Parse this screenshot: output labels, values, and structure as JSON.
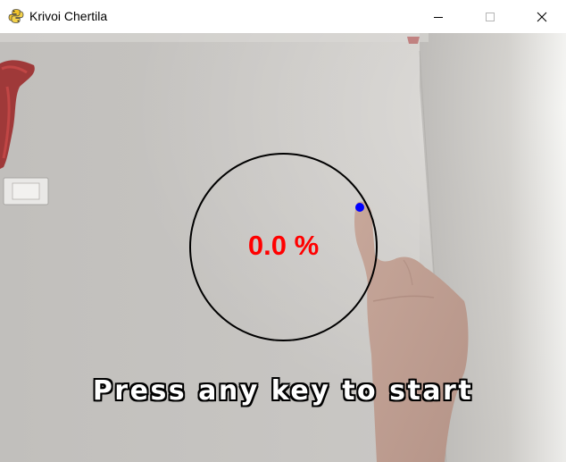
{
  "window": {
    "title": "Krivoi Chertila",
    "app_icon": "python-snake-icon",
    "controls": {
      "minimize_icon": "minimize-icon",
      "maximize_icon": "maximize-icon",
      "close_icon": "close-icon"
    }
  },
  "game": {
    "progress_text": "0.0 %",
    "progress_value": 0.0,
    "prompt": "Press any key to start",
    "colors": {
      "progress_text": "#ff0000",
      "ring": "#000000",
      "cursor": "#0000ff",
      "prompt_fill": "#ffffff",
      "prompt_outline": "#000000"
    }
  }
}
